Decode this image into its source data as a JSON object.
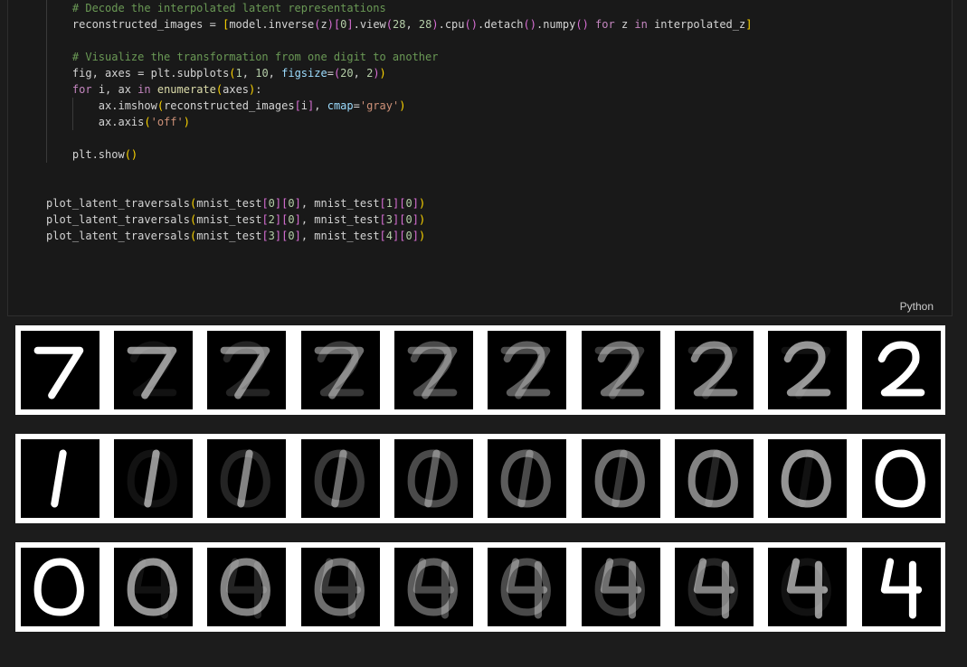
{
  "code_lines": [
    [
      [
        "    ",
        ""
      ],
      [
        "# Decode the interpolated latent representations",
        "c-cm"
      ]
    ],
    [
      [
        "    reconstructed_images = ",
        ""
      ],
      [
        "[",
        "c-par"
      ],
      [
        "model.inverse",
        ""
      ],
      [
        "(",
        "c-br"
      ],
      [
        "z",
        ""
      ],
      [
        ")",
        "c-br"
      ],
      [
        "[",
        "c-br"
      ],
      [
        "0",
        "c-num"
      ],
      [
        "]",
        "c-br"
      ],
      [
        ".view",
        ""
      ],
      [
        "(",
        "c-br"
      ],
      [
        "28",
        "c-num"
      ],
      [
        ", ",
        ""
      ],
      [
        "28",
        "c-num"
      ],
      [
        ")",
        "c-br"
      ],
      [
        ".cpu",
        ""
      ],
      [
        "()",
        "c-br"
      ],
      [
        ".detach",
        ""
      ],
      [
        "()",
        "c-br"
      ],
      [
        ".numpy",
        ""
      ],
      [
        "()",
        "c-br"
      ],
      [
        " ",
        ""
      ],
      [
        "for",
        "c-kw"
      ],
      [
        " z ",
        ""
      ],
      [
        "in",
        "c-kw"
      ],
      [
        " interpolated_z",
        ""
      ],
      [
        "]",
        "c-par"
      ]
    ],
    [
      [
        "",
        ""
      ]
    ],
    [
      [
        "    ",
        ""
      ],
      [
        "# Visualize the transformation from one digit to another",
        "c-cm"
      ]
    ],
    [
      [
        "    fig, axes = plt.subplots",
        ""
      ],
      [
        "(",
        "c-par"
      ],
      [
        "1",
        "c-num"
      ],
      [
        ", ",
        ""
      ],
      [
        "10",
        "c-num"
      ],
      [
        ", ",
        ""
      ],
      [
        "figsize",
        "c-pa"
      ],
      [
        "=",
        ""
      ],
      [
        "(",
        "c-br"
      ],
      [
        "20",
        "c-num"
      ],
      [
        ", ",
        ""
      ],
      [
        "2",
        "c-num"
      ],
      [
        ")",
        "c-br"
      ],
      [
        ")",
        "c-par"
      ]
    ],
    [
      [
        "    ",
        ""
      ],
      [
        "for",
        "c-kw"
      ],
      [
        " i, ax ",
        ""
      ],
      [
        "in",
        "c-kw"
      ],
      [
        " ",
        ""
      ],
      [
        "enumerate",
        "c-fn"
      ],
      [
        "(",
        "c-par"
      ],
      [
        "axes",
        ""
      ],
      [
        ")",
        "c-par"
      ],
      [
        ":",
        ""
      ]
    ],
    [
      [
        "        ax.imshow",
        ""
      ],
      [
        "(",
        "c-par"
      ],
      [
        "reconstructed_images",
        ""
      ],
      [
        "[",
        "c-br"
      ],
      [
        "i",
        ""
      ],
      [
        "]",
        "c-br"
      ],
      [
        ", ",
        ""
      ],
      [
        "cmap",
        "c-pa"
      ],
      [
        "=",
        ""
      ],
      [
        "'gray'",
        "c-str"
      ],
      [
        ")",
        "c-par"
      ]
    ],
    [
      [
        "        ax.axis",
        ""
      ],
      [
        "(",
        "c-par"
      ],
      [
        "'off'",
        "c-str"
      ],
      [
        ")",
        "c-par"
      ]
    ],
    [
      [
        "",
        ""
      ]
    ],
    [
      [
        "    plt.show",
        ""
      ],
      [
        "()",
        "c-par"
      ]
    ],
    [
      [
        "",
        ""
      ]
    ],
    [
      [
        "",
        ""
      ]
    ],
    [
      [
        "plot_latent_traversals",
        ""
      ],
      [
        "(",
        "c-par"
      ],
      [
        "mnist_test",
        ""
      ],
      [
        "[",
        "c-br"
      ],
      [
        "0",
        "c-num"
      ],
      [
        "]",
        "c-br"
      ],
      [
        "[",
        "c-br"
      ],
      [
        "0",
        "c-num"
      ],
      [
        "]",
        "c-br"
      ],
      [
        ", mnist_test",
        ""
      ],
      [
        "[",
        "c-br"
      ],
      [
        "1",
        "c-num"
      ],
      [
        "]",
        "c-br"
      ],
      [
        "[",
        "c-br"
      ],
      [
        "0",
        "c-num"
      ],
      [
        "]",
        "c-br"
      ],
      [
        ")",
        "c-par"
      ]
    ],
    [
      [
        "plot_latent_traversals",
        ""
      ],
      [
        "(",
        "c-par"
      ],
      [
        "mnist_test",
        ""
      ],
      [
        "[",
        "c-br"
      ],
      [
        "2",
        "c-num"
      ],
      [
        "]",
        "c-br"
      ],
      [
        "[",
        "c-br"
      ],
      [
        "0",
        "c-num"
      ],
      [
        "]",
        "c-br"
      ],
      [
        ", mnist_test",
        ""
      ],
      [
        "[",
        "c-br"
      ],
      [
        "3",
        "c-num"
      ],
      [
        "]",
        "c-br"
      ],
      [
        "[",
        "c-br"
      ],
      [
        "0",
        "c-num"
      ],
      [
        "]",
        "c-br"
      ],
      [
        ")",
        "c-par"
      ]
    ],
    [
      [
        "plot_latent_traversals",
        ""
      ],
      [
        "(",
        "c-par"
      ],
      [
        "mnist_test",
        ""
      ],
      [
        "[",
        "c-br"
      ],
      [
        "3",
        "c-num"
      ],
      [
        "]",
        "c-br"
      ],
      [
        "[",
        "c-br"
      ],
      [
        "0",
        "c-num"
      ],
      [
        "]",
        "c-br"
      ],
      [
        ", mnist_test",
        ""
      ],
      [
        "[",
        "c-br"
      ],
      [
        "4",
        "c-num"
      ],
      [
        "]",
        "c-br"
      ],
      [
        "[",
        "c-br"
      ],
      [
        "0",
        "c-num"
      ],
      [
        "]",
        "c-br"
      ],
      [
        ")",
        "c-par"
      ]
    ]
  ],
  "language_label": "Python",
  "output_rows": [
    {
      "from": "7",
      "to": "2"
    },
    {
      "from": "1",
      "to": "0"
    },
    {
      "from": "0",
      "to": "4"
    }
  ]
}
